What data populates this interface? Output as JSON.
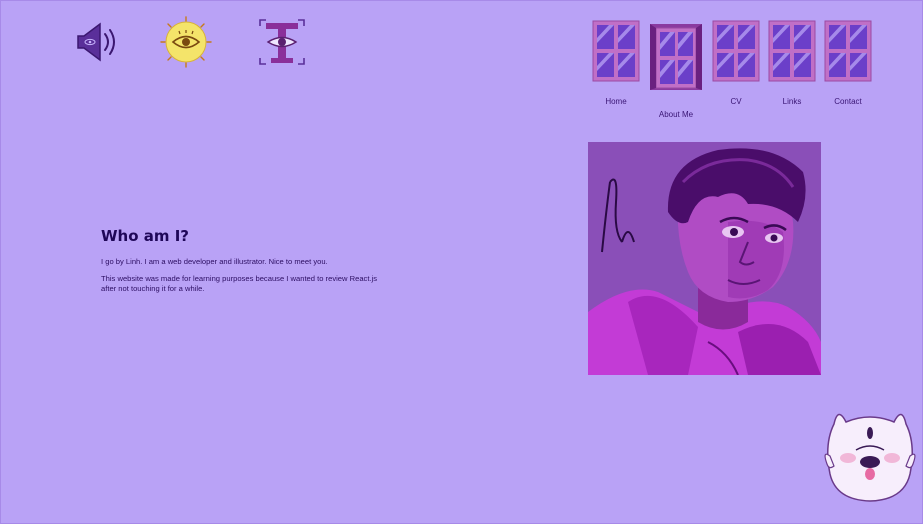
{
  "nav": {
    "home": "Home",
    "about": "About Me",
    "cv": "CV",
    "links": "Links",
    "contact": "Contact"
  },
  "tools": {
    "sound": "megaphone-icon",
    "theme": "sun-eye-icon",
    "font": "font-eye-icon"
  },
  "content": {
    "title": "Who am I?",
    "intro": "I go by Linh. I am a web developer and illustrator. Nice to meet you.",
    "purpose": "This website was made for learning purposes because I wanted to review React.js after not touching it for a while."
  },
  "colors": {
    "background": "#b9a2f6",
    "heading": "#1f0758",
    "window_frame": "#c06fc7",
    "window_glass": "#6b3fc9",
    "accent_yellow": "#f4e46a"
  }
}
